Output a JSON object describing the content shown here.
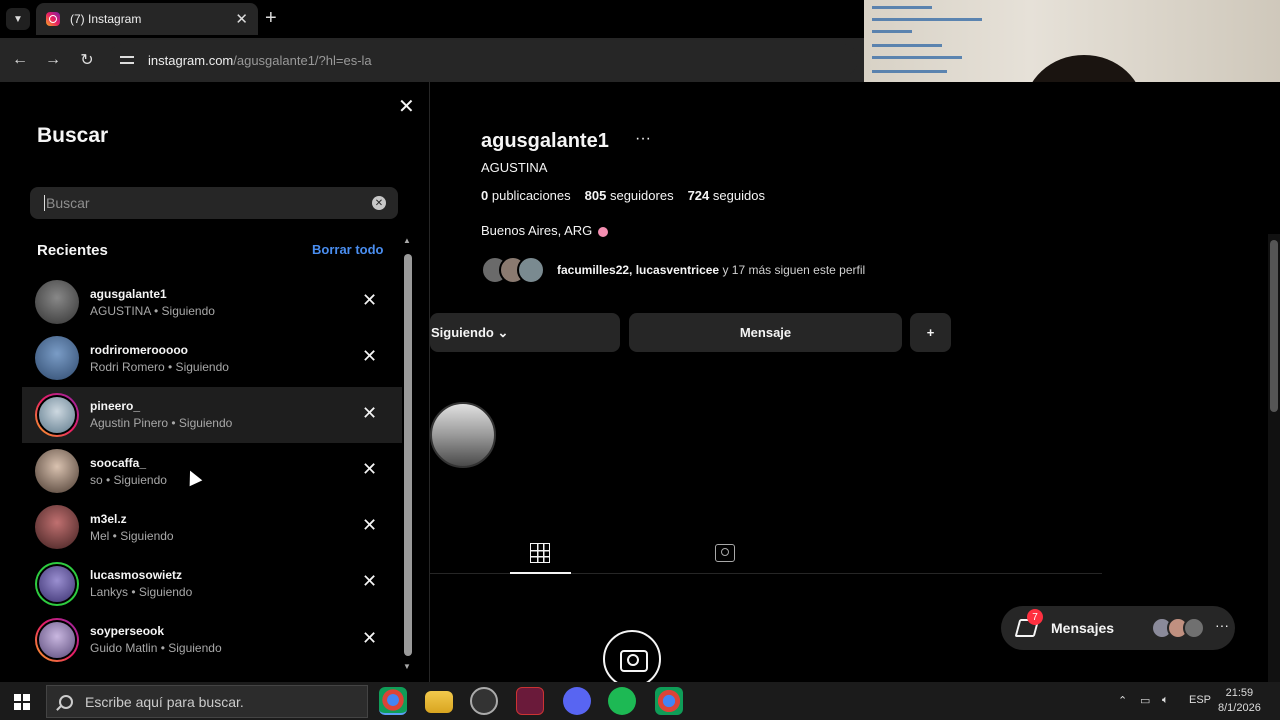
{
  "browser": {
    "tab_title": "(7) Instagram",
    "url_domain": "instagram.com",
    "url_path": "/agusgalante1/?hl=es-la"
  },
  "search_panel": {
    "title": "Buscar",
    "placeholder": "Buscar",
    "recent_heading": "Recientes",
    "clear_all": "Borrar todo",
    "items": [
      {
        "username": "agusgalante1",
        "subtitle": "AGUSTINA • Siguiendo"
      },
      {
        "username": "rodriromerooooo",
        "subtitle": "Rodri Romero • Siguiendo"
      },
      {
        "username": "pineero_",
        "subtitle": "Agustin Pinero • Siguiendo"
      },
      {
        "username": "soocaffa_",
        "subtitle": "so • Siguiendo"
      },
      {
        "username": "m3el.z",
        "subtitle": "Mel • Siguiendo"
      },
      {
        "username": "lucasmosowietz",
        "subtitle": "Lankys • Siguiendo"
      },
      {
        "username": "soyperseook",
        "subtitle": "Guido Matlin • Siguiendo"
      }
    ]
  },
  "profile": {
    "username": "agusgalante1",
    "more": "···",
    "full_name": "AGUSTINA",
    "posts_count": "0",
    "posts_label": "publicaciones",
    "followers_count": "805",
    "followers_label": "seguidores",
    "following_count": "724",
    "following_label": "seguidos",
    "location": "Buenos Aires, ARG",
    "mutual_names": "facumilles22, lucasventricee",
    "mutual_rest": "y 17 más siguen este perfil",
    "following_button": "Siguiendo",
    "message_button": "Mensaje",
    "add_user_glyph": "+"
  },
  "messages_bar": {
    "label": "Mensajes",
    "badge": "7",
    "more": "···"
  },
  "taskbar": {
    "search_placeholder": "Escribe aquí para buscar.",
    "language": "ESP",
    "time": "21:59",
    "date": "8/1/2026"
  },
  "colors": {
    "background": "#000000",
    "surface": "#262626",
    "link_blue": "#4a8ef0",
    "badge_red": "#ff3040"
  }
}
